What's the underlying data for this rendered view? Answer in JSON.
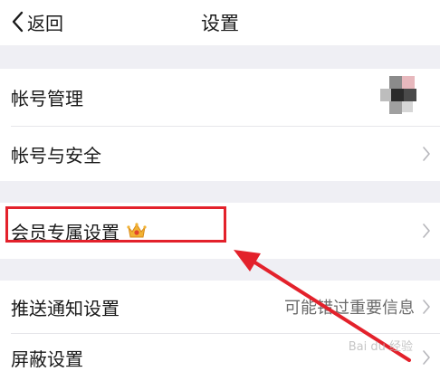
{
  "nav": {
    "back_label": "返回",
    "title": "设置"
  },
  "rows": {
    "account_manage": "帐号管理",
    "account_security": "帐号与安全",
    "member_settings": "会员专属设置",
    "push_notify": "推送通知设置",
    "push_notify_value": "可能错过重要信息",
    "block_settings": "屏蔽设置"
  },
  "colors": {
    "separator": "#efeff4",
    "highlight": "#e3212b"
  },
  "watermark": "Bai du 经验"
}
